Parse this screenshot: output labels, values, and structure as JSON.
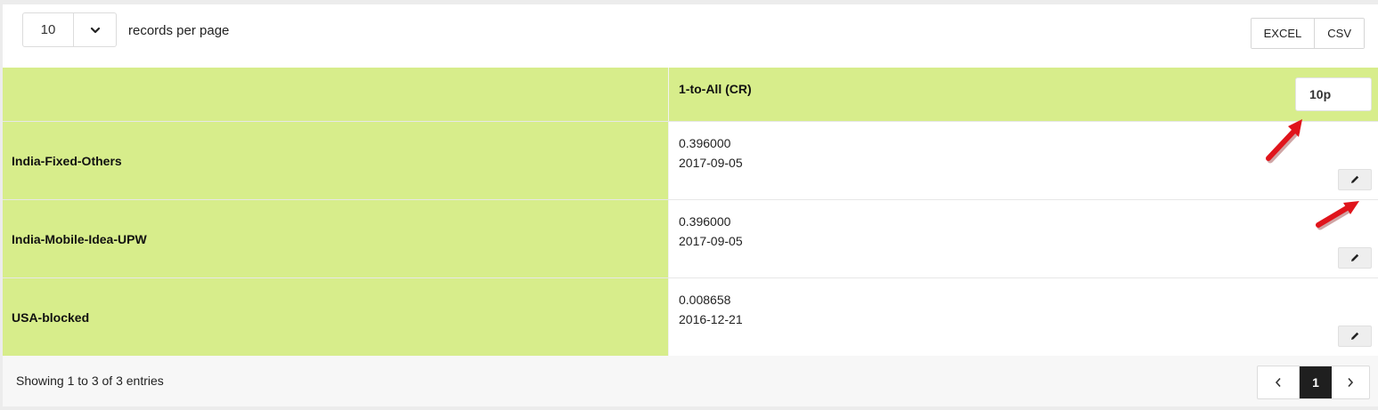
{
  "length_menu": {
    "value": "10",
    "label": "records per page"
  },
  "export": {
    "excel_label": "EXCEL",
    "csv_label": "CSV"
  },
  "table": {
    "header": {
      "column_title": "1-to-All (CR)",
      "filter_value": "10p"
    },
    "rows": [
      {
        "name": "India-Fixed-Others",
        "rate": "0.396000",
        "date": "2017-09-05"
      },
      {
        "name": "India-Mobile-Idea-UPW",
        "rate": "0.396000",
        "date": "2017-09-05"
      },
      {
        "name": "USA-blocked",
        "rate": "0.008658",
        "date": "2016-12-21"
      }
    ]
  },
  "footer": {
    "info": "Showing 1 to 3 of 3 entries",
    "pagination": {
      "current_page": "1"
    }
  },
  "colors": {
    "header_green": "#d7ed8b",
    "annotation_arrow": "#e0141b",
    "active_page": "#1f1f1f"
  }
}
